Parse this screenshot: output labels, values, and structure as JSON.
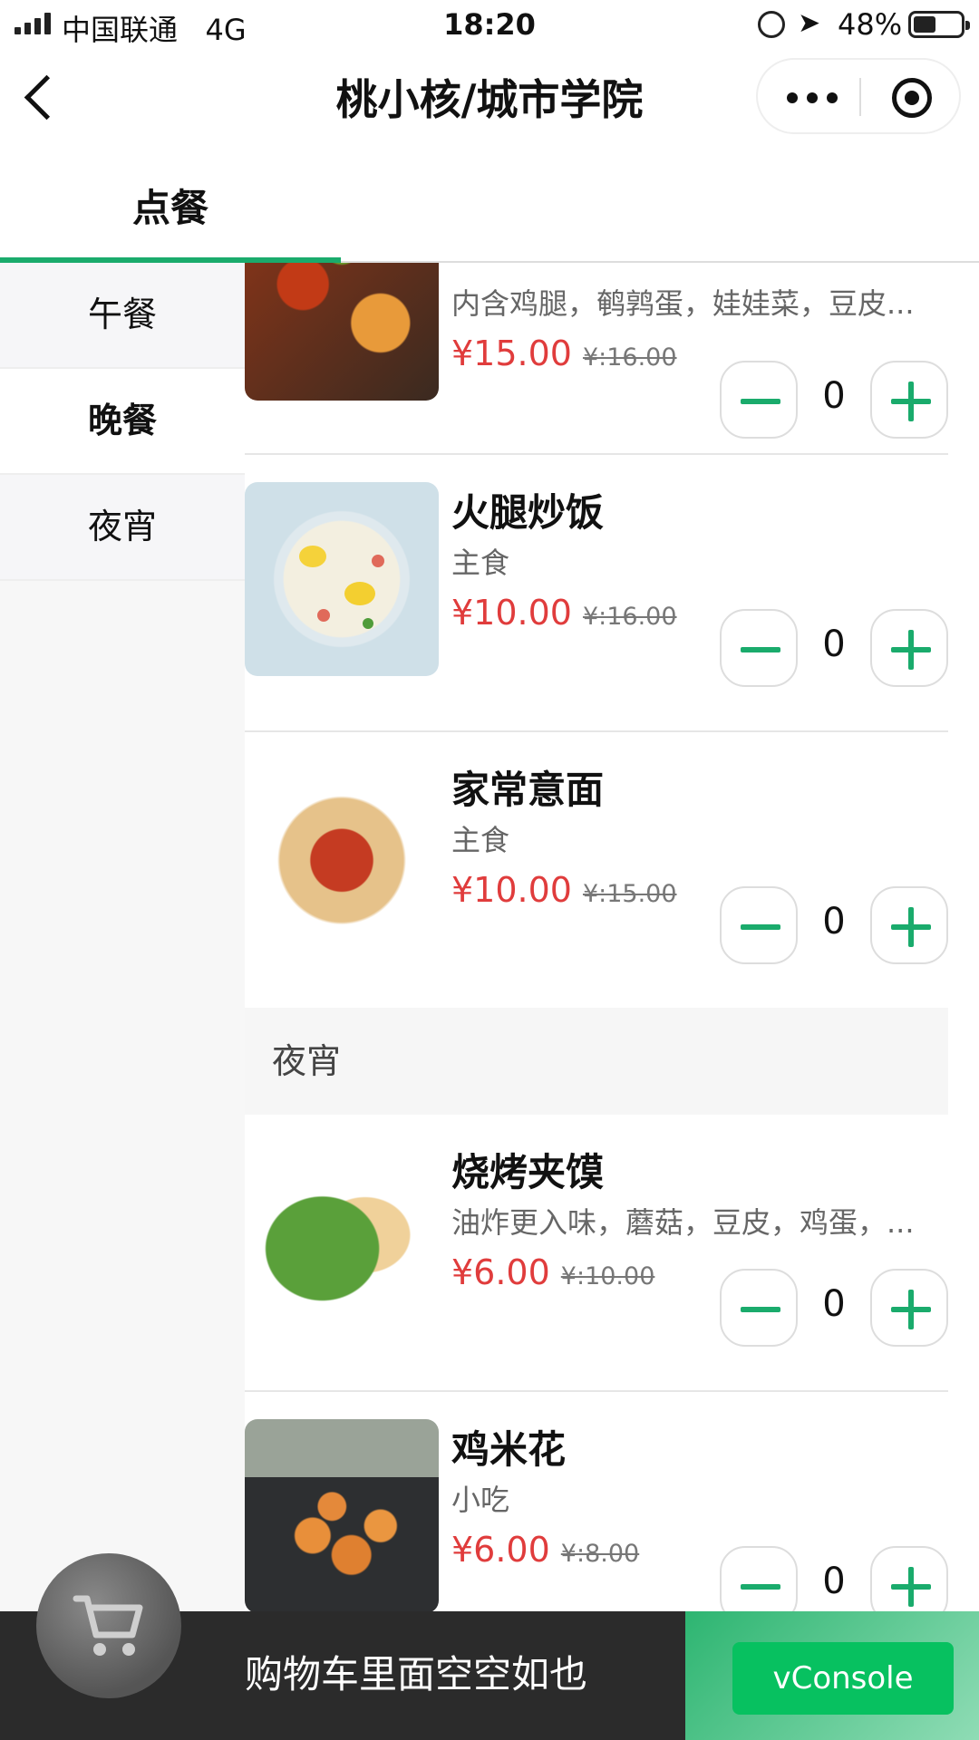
{
  "status_bar": {
    "carrier": "中国联通",
    "network": "4G",
    "time": "18:20",
    "battery": "48%"
  },
  "nav": {
    "title": "桃小核/城市学院"
  },
  "tabs": [
    {
      "label": "点餐"
    }
  ],
  "sidebar": {
    "items": [
      {
        "label": "午餐"
      },
      {
        "label": "晚餐"
      },
      {
        "label": "夜宵"
      }
    ]
  },
  "menu": {
    "items": [
      {
        "desc": "内含鸡腿，鹌鹑蛋，娃娃菜，豆皮...",
        "price": "¥15.00",
        "old_price": "¥:16.00",
        "qty": "0"
      },
      {
        "name": "火腿炒饭",
        "desc": "主食",
        "price": "¥10.00",
        "old_price": "¥:16.00",
        "qty": "0"
      },
      {
        "name": "家常意面",
        "desc": "主食",
        "price": "¥10.00",
        "old_price": "¥:15.00",
        "qty": "0"
      },
      {
        "name": "烧烤夹馍",
        "desc": "油炸更入味，蘑菇，豆皮，鸡蛋，...",
        "price": "¥6.00",
        "old_price": "¥:10.00",
        "qty": "0"
      },
      {
        "name": "鸡米花",
        "desc": "小吃",
        "price": "¥6.00",
        "old_price": "¥:8.00",
        "qty": "0"
      }
    ],
    "section_header": "夜宵"
  },
  "cart": {
    "empty_text": "购物车里面空空如也"
  },
  "vconsole": {
    "label": "vConsole"
  },
  "colors": {
    "accent": "#1aab6c",
    "price": "#e03c3c",
    "vconsole": "#07c160"
  }
}
